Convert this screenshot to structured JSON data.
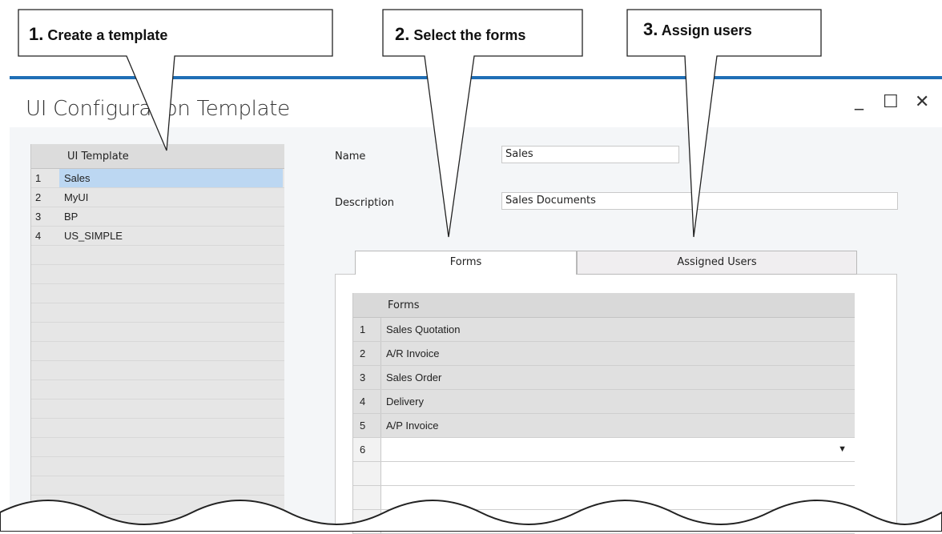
{
  "window": {
    "title": "UI Configuration Template",
    "controls": {
      "minimize": "_",
      "maximize": "☐",
      "close": "✕"
    }
  },
  "template_list": {
    "header": "UI Template",
    "rows": [
      {
        "num": "1",
        "name": "Sales",
        "selected": true
      },
      {
        "num": "2",
        "name": "MyUI",
        "selected": false
      },
      {
        "num": "3",
        "name": "BP",
        "selected": false
      },
      {
        "num": "4",
        "name": "US_SIMPLE",
        "selected": false
      }
    ]
  },
  "details": {
    "name_label": "Name",
    "name_value": "Sales",
    "description_label": "Description",
    "description_value": "Sales Documents"
  },
  "tabs": [
    {
      "label": "Forms",
      "active": true
    },
    {
      "label": "Assigned Users",
      "active": false
    }
  ],
  "forms_grid": {
    "header": "Forms",
    "rows": [
      {
        "num": "1",
        "name": "Sales Quotation"
      },
      {
        "num": "2",
        "name": "A/R Invoice"
      },
      {
        "num": "3",
        "name": "Sales Order"
      },
      {
        "num": "4",
        "name": "Delivery"
      },
      {
        "num": "5",
        "name": "A/P Invoice"
      },
      {
        "num": "6",
        "name": ""
      }
    ]
  },
  "callouts": [
    {
      "num": "1.",
      "text": "Create a template"
    },
    {
      "num": "2.",
      "text": "Select the forms"
    },
    {
      "num": "3.",
      "text": "Assign users"
    }
  ]
}
